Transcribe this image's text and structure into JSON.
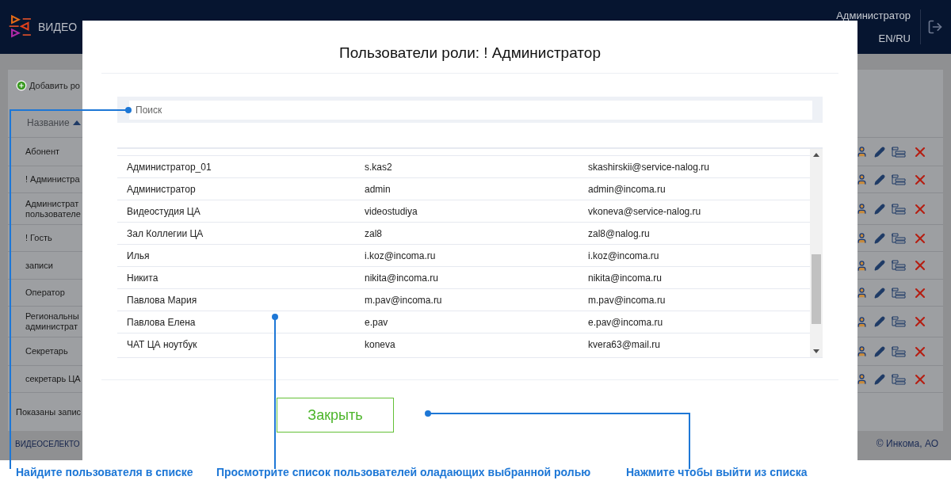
{
  "header": {
    "logo_text": "ВИДЕО",
    "user": "Администратор",
    "language": "EN/RU"
  },
  "background": {
    "add_button": "Добавить ро",
    "column": "Название",
    "rows": [
      {
        "name": "Абонент"
      },
      {
        "name": "! Администра"
      },
      {
        "name": "Администрат\nпользователе"
      },
      {
        "name": "! Гость"
      },
      {
        "name": "записи"
      },
      {
        "name": "Оператор"
      },
      {
        "name": "Региональны\nадминистрат"
      },
      {
        "name": "Секретарь"
      },
      {
        "name": "секретарь ЦА"
      }
    ],
    "footer_text": "Показаны запис",
    "brand": "ВИДЕОСЕЛЕКТО",
    "copyright": "© Инкома, АО"
  },
  "dialog": {
    "title": "Пользователи роли: ! Администратор",
    "search": {
      "placeholder": "Поиск"
    },
    "users": [
      {
        "name": "Администратор_01",
        "login": "s.kas2",
        "email": "skashirskii@service-nalog.ru"
      },
      {
        "name": "Администратор",
        "login": "admin",
        "email": "admin@incoma.ru"
      },
      {
        "name": "Видеостудия ЦА",
        "login": "videostudiya",
        "email": "vkoneva@service-nalog.ru"
      },
      {
        "name": "Зал Коллегии ЦА",
        "login": "zal8",
        "email": "zal8@nalog.ru"
      },
      {
        "name": "Илья",
        "login": "i.koz@incoma.ru",
        "email": "i.koz@incoma.ru"
      },
      {
        "name": "Никита",
        "login": "nikita@incoma.ru",
        "email": "nikita@incoma.ru"
      },
      {
        "name": "Павлова Мария",
        "login": "m.pav@incoma.ru",
        "email": "m.pav@incoma.ru"
      },
      {
        "name": "Павлова Елена",
        "login": "e.pav",
        "email": "e.pav@incoma.ru"
      },
      {
        "name": "ЧАТ ЦА ноутбук",
        "login": "koneva",
        "email": "kvera63@mail.ru"
      }
    ],
    "close_button": "Закрыть"
  },
  "annotations": [
    {
      "text": "Найдите пользователя в списке"
    },
    {
      "text": "Просмотрите список пользователей оладающих выбранной ролью"
    },
    {
      "text": "Нажмите чтобы выйти из списка"
    }
  ]
}
